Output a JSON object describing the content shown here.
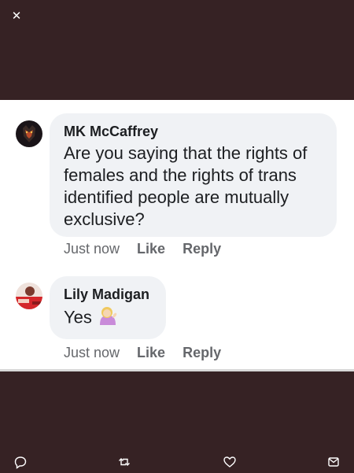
{
  "comments": [
    {
      "author": "MK McCaffrey",
      "text": "Are you saying that the rights of females and the rights of trans identified people are mutually exclusive?",
      "timestamp": "Just now",
      "like_label": "Like",
      "reply_label": "Reply"
    },
    {
      "author": "Lily Madigan",
      "text": "Yes",
      "emoji": "woman-tipping-hand",
      "timestamp": "Just now",
      "like_label": "Like",
      "reply_label": "Reply"
    }
  ],
  "icons": {
    "close": "close-icon",
    "reply": "reply-icon",
    "retweet": "retweet-icon",
    "like": "heart-icon",
    "share": "share-icon"
  },
  "colors": {
    "background": "#362224",
    "bubble": "#f0f2f5",
    "meta_text": "#65676b"
  }
}
